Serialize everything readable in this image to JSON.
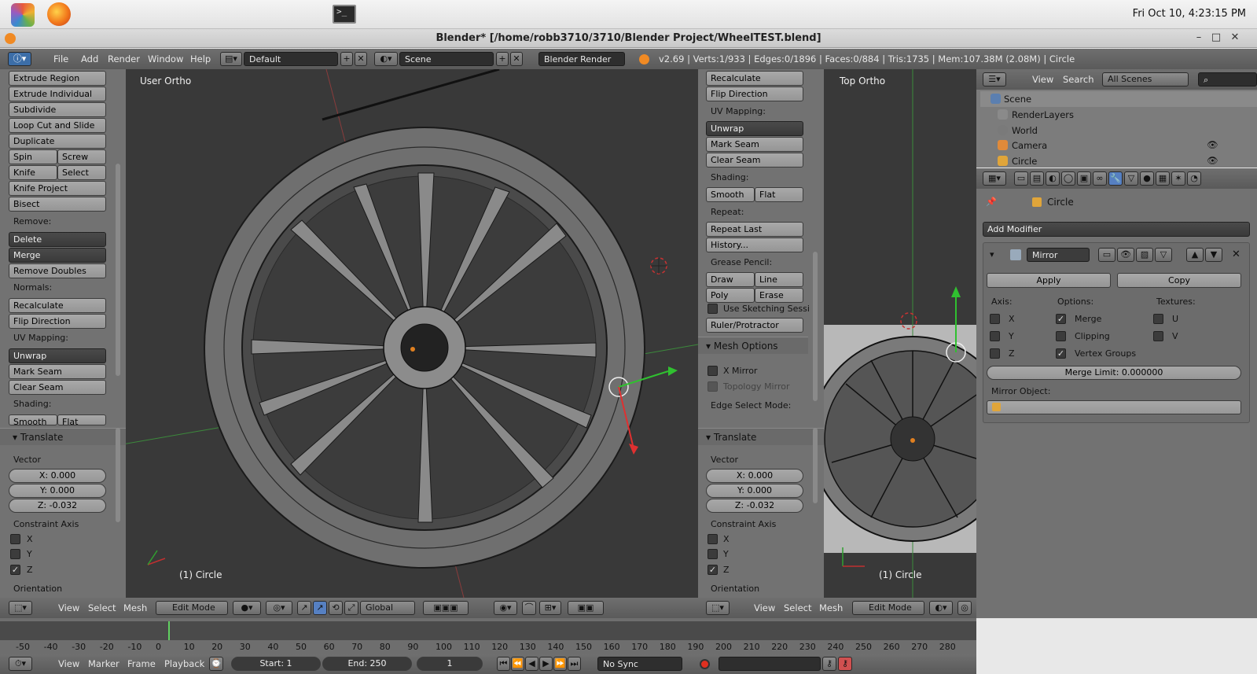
{
  "os": {
    "clock": "Fri Oct 10,  4:23:15 PM"
  },
  "window": {
    "title": "Blender* [/home/robb3710/3710/Blender Project/WheelTEST.blend]",
    "minimize": "–",
    "maximize": "□",
    "close": "✕"
  },
  "info_header": {
    "menus": [
      "File",
      "Add",
      "Render",
      "Window",
      "Help"
    ],
    "layout": "Default",
    "scene": "Scene",
    "engine": "Blender Render",
    "stats": "v2.69 | Verts:1/933 | Edges:0/1896 | Faces:0/884 | Tris:1735 | Mem:107.38M (2.08M) | Circle"
  },
  "left_tools": {
    "buttons": [
      "Extrude Region",
      "Extrude Individual",
      "Subdivide",
      "Loop Cut and Slide",
      "Duplicate"
    ],
    "spin": "Spin",
    "screw": "Screw",
    "knife": "Knife",
    "select": "Select",
    "knife_project": "Knife Project",
    "bisect": "Bisect",
    "remove_label": "Remove:",
    "delete": "Delete",
    "merge": "Merge",
    "remove_doubles": "Remove Doubles",
    "normals_label": "Normals:",
    "recalculate": "Recalculate",
    "flip_direction": "Flip Direction",
    "uv_label": "UV Mapping:",
    "unwrap": "Unwrap",
    "mark_seam": "Mark Seam",
    "clear_seam": "Clear Seam",
    "shading_label": "Shading:",
    "smooth": "Smooth",
    "flat": "Flat"
  },
  "translate_op": {
    "title": "Translate",
    "vector_label": "Vector",
    "x": "X: 0.000",
    "y": "Y: 0.000",
    "z": "Z: -0.032",
    "constraint_label": "Constraint Axis",
    "axes": [
      "X",
      "Y",
      "Z"
    ],
    "axes_checked": [
      false,
      false,
      true
    ],
    "orientation_label": "Orientation"
  },
  "mid_tools": {
    "recalculate": "Recalculate",
    "flip_direction": "Flip Direction",
    "uv_label": "UV Mapping:",
    "unwrap": "Unwrap",
    "mark_seam": "Mark Seam",
    "clear_seam": "Clear Seam",
    "shading_label": "Shading:",
    "smooth": "Smooth",
    "flat": "Flat",
    "repeat_label": "Repeat:",
    "repeat_last": "Repeat Last",
    "history": "History...",
    "grease_label": "Grease Pencil:",
    "draw": "Draw",
    "line": "Line",
    "poly": "Poly",
    "erase": "Erase",
    "use_sketching": "Use Sketching Sessi",
    "ruler": "Ruler/Protractor",
    "mesh_options": "Mesh Options",
    "x_mirror": "X Mirror",
    "topology_mirror": "Topology Mirror",
    "edge_select_mode": "Edge Select Mode:"
  },
  "viewport_left": {
    "label": "User Ortho",
    "object": "(1) Circle"
  },
  "viewport_right": {
    "label": "Top Ortho",
    "object": "(1) Circle"
  },
  "view_header_left": {
    "menus": [
      "View",
      "Select",
      "Mesh"
    ],
    "mode": "Edit Mode",
    "orientation": "Global"
  },
  "view_header_right": {
    "menus": [
      "View",
      "Select",
      "Mesh"
    ],
    "mode": "Edit Mode"
  },
  "outliner": {
    "menus": [
      "View",
      "Search"
    ],
    "filter": "All Scenes",
    "rows": [
      {
        "name": "Scene",
        "color": "#5b7fb0"
      },
      {
        "name": "RenderLayers",
        "color": "#8a8a8a"
      },
      {
        "name": "World",
        "color": "#7a7a7a"
      },
      {
        "name": "Camera",
        "color": "#e08a3a"
      },
      {
        "name": "Circle",
        "color": "#e0a53a"
      }
    ]
  },
  "properties": {
    "object_name": "Circle",
    "add_modifier": "Add Modifier",
    "modifier_name": "Mirror",
    "apply": "Apply",
    "copy": "Copy",
    "axis_label": "Axis:",
    "options_label": "Options:",
    "textures_label": "Textures:",
    "axes": [
      "X",
      "Y",
      "Z"
    ],
    "merge": "Merge",
    "clipping": "Clipping",
    "vertex_groups": "Vertex Groups",
    "tex_u": "U",
    "tex_v": "V",
    "merge_limit": "Merge Limit: 0.000000",
    "mirror_object_label": "Mirror Object:"
  },
  "timeline": {
    "ticks": [
      "-50",
      "-40",
      "-30",
      "-20",
      "-10",
      "0",
      "10",
      "20",
      "30",
      "40",
      "50",
      "60",
      "70",
      "80",
      "90",
      "100",
      "110",
      "120",
      "130",
      "140",
      "150",
      "160",
      "170",
      "180",
      "190",
      "200",
      "210",
      "220",
      "230",
      "240",
      "250",
      "260",
      "270",
      "280"
    ],
    "menus": [
      "View",
      "Marker",
      "Frame",
      "Playback"
    ],
    "start": "Start: 1",
    "end": "End: 250",
    "current": "1",
    "sync": "No Sync"
  }
}
